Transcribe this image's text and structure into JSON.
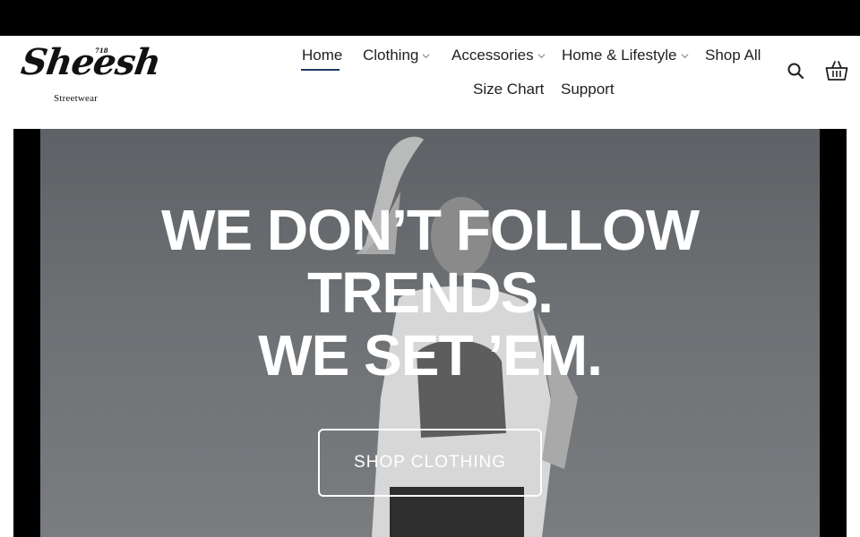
{
  "brand": {
    "name": "Sheesh",
    "tag": "718",
    "subtitle": "Streetwear"
  },
  "nav": {
    "items": [
      {
        "label": "Home",
        "active": true,
        "has_dropdown": false
      },
      {
        "label": "Clothing",
        "active": false,
        "has_dropdown": true
      },
      {
        "label": "Accessories",
        "active": false,
        "has_dropdown": true
      },
      {
        "label": "Home & Lifestyle",
        "active": false,
        "has_dropdown": true
      },
      {
        "label": "Shop All",
        "active": false,
        "has_dropdown": false
      },
      {
        "label": "Size Chart",
        "active": false,
        "has_dropdown": false
      },
      {
        "label": "Support",
        "active": false,
        "has_dropdown": false
      }
    ]
  },
  "header_icons": {
    "search": "search-icon",
    "cart": "basket-icon"
  },
  "hero": {
    "headline_line1": "WE DON’T FOLLOW",
    "headline_line2": "TRENDS.",
    "headline_line3": "WE SET ’EM.",
    "cta_label": "SHOP CLOTHING"
  },
  "colors": {
    "topbar": "#000000",
    "active_underline": "#1d3a5f",
    "text": "#1f1f1f",
    "hero_text": "#ffffff"
  }
}
